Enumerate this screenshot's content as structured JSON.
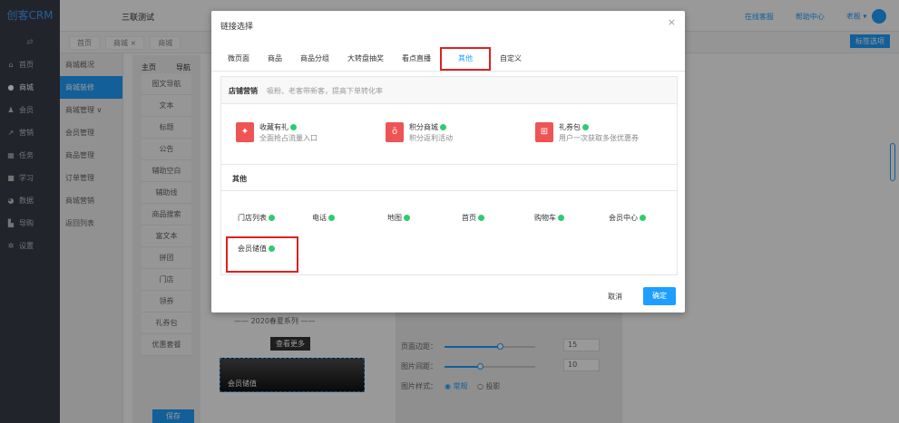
{
  "app": {
    "logo": "创客CRM",
    "title": "三联测试"
  },
  "topnav": {
    "service": "在线客服",
    "help": "帮助中心",
    "user": "老板",
    "avatar": "1"
  },
  "sidebar": {
    "items": [
      {
        "label": "首页",
        "icon": "home-icon"
      },
      {
        "label": "商城",
        "icon": "shop-icon"
      },
      {
        "label": "会员",
        "icon": "user-icon"
      },
      {
        "label": "营销",
        "icon": "trend-icon"
      },
      {
        "label": "任务",
        "icon": "grid-icon"
      },
      {
        "label": "学习",
        "icon": "book-icon"
      },
      {
        "label": "数据",
        "icon": "data-icon"
      },
      {
        "label": "导购",
        "icon": "guide-icon"
      },
      {
        "label": "设置",
        "icon": "gear-icon"
      }
    ]
  },
  "subnav": {
    "items": [
      "商城概况",
      "商城装修",
      "商城管理 ∨",
      "会员管理",
      "商品管理",
      "订单管理",
      "商城营销",
      "返回列表"
    ]
  },
  "tabbar": {
    "tabs": [
      "首页",
      "商城 ×",
      "商城"
    ],
    "options": "标签选项"
  },
  "editor": {
    "tab1": "主页",
    "tab2": "导航",
    "components": [
      "图文导航",
      "文本",
      "标题",
      "公告",
      "辅助空白",
      "辅助线",
      "商品搜索",
      "富文本",
      "拼团",
      "门店",
      "领券",
      "礼券包",
      "优惠套餐"
    ],
    "save": "保存",
    "series": "—— 2020春夏系列 ——",
    "more": "查看更多",
    "banner": "会员储值"
  },
  "props": {
    "margin_label": "页面边距：",
    "margin_value": "15",
    "gap_label": "图片间距：",
    "gap_value": "10",
    "style_label": "图片样式：",
    "style_opt1": "常规",
    "style_opt2": "投影"
  },
  "modal": {
    "title": "链接选择",
    "close": "×",
    "tabs": [
      "微页面",
      "商品",
      "商品分组",
      "大转盘抽奖",
      "看点直播",
      "其他",
      "自定义"
    ],
    "active_tab": 5,
    "sec1_title": "店铺营销",
    "sec1_sub": "吸粉、老客带新客，提高下单转化率",
    "cards": [
      {
        "title": "收藏有礼",
        "desc": "全面抢占流量入口",
        "icon": "gift-box-icon"
      },
      {
        "title": "积分商城",
        "desc": "积分返利活动",
        "icon": "money-bag-icon"
      },
      {
        "title": "礼券包",
        "desc": "用户一次获取多张优惠券",
        "icon": "present-icon"
      }
    ],
    "sec2_title": "其他",
    "links": [
      "门店列表",
      "电话",
      "地图",
      "首页",
      "购物车",
      "会员中心",
      "会员储值"
    ],
    "cancel": "取消",
    "confirm": "确定"
  }
}
